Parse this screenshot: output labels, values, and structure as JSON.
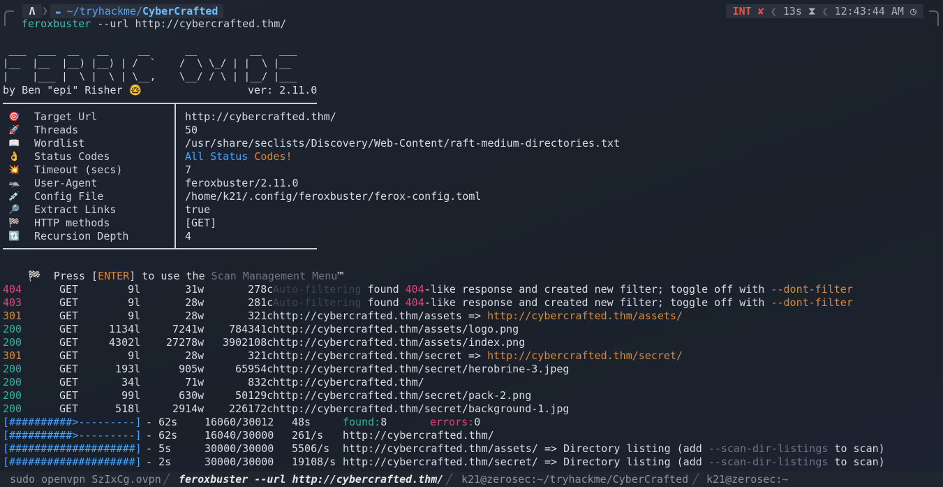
{
  "prompt": {
    "os_icon": "arch-icon",
    "folder_icon": "folder-icon",
    "path_prefix": "~/tryhackme/",
    "path_dir": "CyberCrafted",
    "int_label": "INT",
    "int_mark": "✘",
    "duration": "13s",
    "hourglass": "⧗",
    "time": "12:43:44 AM",
    "clock_icon": "clock-icon"
  },
  "command": {
    "name": "feroxbuster",
    "args": "--url http://cybercrafted.thm/"
  },
  "banner": {
    "art_line1": " ___  ___  __   __     __      __         __   ___",
    "art_line2": "|__  |__  |__) |__) | /  `    /  \\ \\_/ | |  \\ |__",
    "art_line3": "|    |___ |  \\ |  \\ | \\__,    \\__/ / \\ | |__/ |___",
    "author": "by Ben \"epi\" Risher 🤓",
    "version": "ver: 2.11.0"
  },
  "config": [
    {
      "icon": "🎯",
      "icon_name": "target-icon",
      "label": "Target Url",
      "value": "http://cybercrafted.thm/"
    },
    {
      "icon": "🚀",
      "icon_name": "rocket-icon",
      "label": "Threads",
      "value": "50"
    },
    {
      "icon": "📖",
      "icon_name": "book-icon",
      "label": "Wordlist",
      "value": "/usr/share/seclists/Discovery/Web-Content/raft-medium-directories.txt"
    },
    {
      "icon": "👌",
      "icon_name": "ok-hand-icon",
      "label": "Status Codes",
      "value_parts": [
        "All",
        "Status",
        "Codes!"
      ]
    },
    {
      "icon": "💥",
      "icon_name": "collision-icon",
      "label": "Timeout (secs)",
      "value": "7"
    },
    {
      "icon": "🦡",
      "icon_name": "badger-icon",
      "label": "User-Agent",
      "value": "feroxbuster/2.11.0"
    },
    {
      "icon": "💉",
      "icon_name": "syringe-icon",
      "label": "Config File",
      "value": "/home/k21/.config/feroxbuster/ferox-config.toml"
    },
    {
      "icon": "🔎",
      "icon_name": "magnifier-icon",
      "label": "Extract Links",
      "value": "true"
    },
    {
      "icon": "🏁",
      "icon_name": "checkered-flag-icon",
      "label": "HTTP methods",
      "value": "[GET]"
    },
    {
      "icon": "🔃",
      "icon_name": "reload-icon",
      "label": "Recursion Depth",
      "value": "4"
    }
  ],
  "menu_line": {
    "icon": "🏁",
    "press": "Press [",
    "key": "ENTER",
    "rest": "] to use the ",
    "menu": "Scan Management Menu",
    "tm": "™"
  },
  "results": [
    {
      "code": "404",
      "method": "GET",
      "lines": "9l",
      "words": "31w",
      "chars": "278c",
      "text_dim": "Auto-filtering",
      "text_a": " found ",
      "text_code": "404",
      "text_b": "-like response and created new filter; toggle off with ",
      "flag": "--dont-filter"
    },
    {
      "code": "403",
      "method": "GET",
      "lines": "9l",
      "words": "28w",
      "chars": "281c",
      "text_dim": "Auto-filtering",
      "text_a": " found ",
      "text_code": "404",
      "text_b": "-like response and created new filter; toggle off with ",
      "flag": "--dont-filter"
    },
    {
      "code": "301",
      "method": "GET",
      "lines": "9l",
      "words": "28w",
      "chars": "321c",
      "url": "http://cybercrafted.thm/assets",
      "arrow": " => ",
      "redirect": "http://cybercrafted.thm/assets/"
    },
    {
      "code": "200",
      "method": "GET",
      "lines": "1134l",
      "words": "7241w",
      "chars": "784341c",
      "url": "http://cybercrafted.thm/assets/logo.png"
    },
    {
      "code": "200",
      "method": "GET",
      "lines": "4302l",
      "words": "27278w",
      "chars": "3902108c",
      "url": "http://cybercrafted.thm/assets/index.png"
    },
    {
      "code": "301",
      "method": "GET",
      "lines": "9l",
      "words": "28w",
      "chars": "321c",
      "url": "http://cybercrafted.thm/secret",
      "arrow": " => ",
      "redirect": "http://cybercrafted.thm/secret/"
    },
    {
      "code": "200",
      "method": "GET",
      "lines": "193l",
      "words": "905w",
      "chars": "65954c",
      "url": "http://cybercrafted.thm/secret/herobrine-3.jpeg"
    },
    {
      "code": "200",
      "method": "GET",
      "lines": "34l",
      "words": "71w",
      "chars": "832c",
      "url": "http://cybercrafted.thm/"
    },
    {
      "code": "200",
      "method": "GET",
      "lines": "99l",
      "words": "630w",
      "chars": "50129c",
      "url": "http://cybercrafted.thm/secret/pack-2.png"
    },
    {
      "code": "200",
      "method": "GET",
      "lines": "518l",
      "words": "2914w",
      "chars": "226172c",
      "url": "http://cybercrafted.thm/secret/background-1.jpg"
    }
  ],
  "progress": [
    {
      "bar_done": "[##########>",
      "bar_rest": "---------]",
      "sep": " - ",
      "time": "62s",
      "count": "16060/30012",
      "rate": "48s",
      "found_label": "found:",
      "found": "8",
      "errors_label": "errors:",
      "errors": "0"
    },
    {
      "bar_done": "[##########>",
      "bar_rest": "---------]",
      "sep": " - ",
      "time": "62s",
      "count": "16040/30000",
      "rate": "261/s",
      "url": "http://cybercrafted.thm/"
    },
    {
      "bar_done": "[####################]",
      "bar_rest": "",
      "sep": " - ",
      "time": "5s",
      "count": "30000/30000",
      "rate": "5506/s",
      "url": "http://cybercrafted.thm/assets/",
      "note_a": " => Directory listing (add ",
      "note_flag": "--scan-dir-listings",
      "note_b": " to scan)"
    },
    {
      "bar_done": "[####################]",
      "bar_rest": "",
      "sep": " - ",
      "time": "2s",
      "count": "30000/30000",
      "rate": "19108/s",
      "url": "http://cybercrafted.thm/secret/",
      "note_a": " => Directory listing (add ",
      "note_flag": "--scan-dir-listings",
      "note_b": " to scan)"
    }
  ],
  "tabs": [
    {
      "label": "sudo openvpn SzIxCg.ovpn",
      "active": false
    },
    {
      "label": "feroxbuster --url http://cybercrafted.thm/",
      "active": true
    },
    {
      "label": "k21@zerosec:~/tryhackme/CyberCrafted",
      "active": false
    },
    {
      "label": "k21@zerosec:~",
      "active": false
    }
  ],
  "colors": {
    "background": "#1b222d",
    "code_200": "#2fb3a5",
    "code_301": "#d9893c",
    "code_40x": "#e0457b",
    "accent_blue": "#4aa3ff"
  }
}
